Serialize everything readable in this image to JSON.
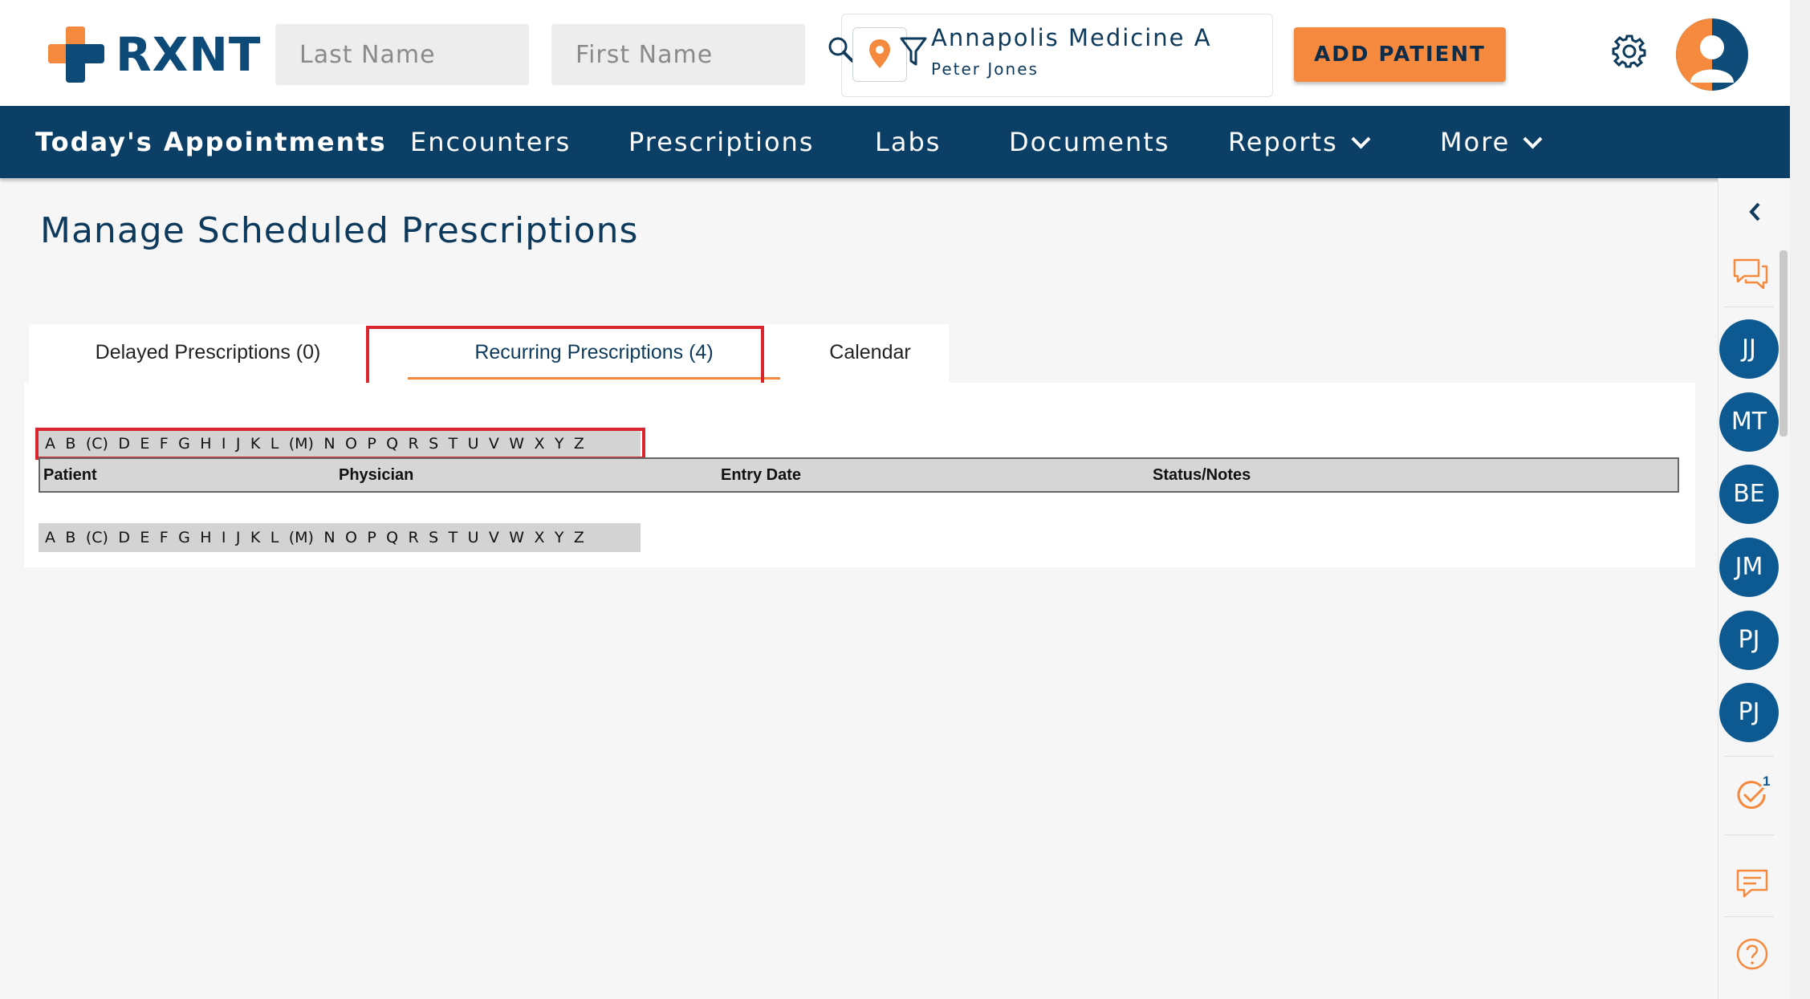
{
  "header": {
    "logo_text": "RXNT",
    "search": {
      "last_name_placeholder": "Last Name",
      "first_name_placeholder": "First Name"
    },
    "location": {
      "name": "Annapolis Medicine A",
      "user": "Peter Jones"
    },
    "add_patient_label": "ADD PATIENT",
    "colors": {
      "brand_blue": "#0e4a77",
      "accent_orange": "#f58a3f"
    }
  },
  "nav": {
    "items": [
      {
        "label": "Today's Appointments",
        "active": true
      },
      {
        "label": "Encounters"
      },
      {
        "label": "Prescriptions"
      },
      {
        "label": "Labs"
      },
      {
        "label": "Documents"
      },
      {
        "label": "Reports",
        "dropdown": true
      },
      {
        "label": "More",
        "dropdown": true
      }
    ]
  },
  "page": {
    "title": "Manage Scheduled Prescriptions",
    "tabs": [
      {
        "label": "Delayed Prescriptions (0)"
      },
      {
        "label": "Recurring Prescriptions (4)",
        "selected": true
      },
      {
        "label": "Calendar"
      }
    ],
    "alphabet": [
      "A",
      "B",
      "(C)",
      "D",
      "E",
      "F",
      "G",
      "H",
      "I",
      "J",
      "K",
      "L",
      "(M)",
      "N",
      "O",
      "P",
      "Q",
      "R",
      "S",
      "T",
      "U",
      "V",
      "W",
      "X",
      "Y",
      "Z"
    ],
    "table": {
      "columns": [
        "Patient",
        "Physician",
        "Entry Date",
        "Status/Notes"
      ]
    }
  },
  "sidebar": {
    "contacts": [
      "JJ",
      "MT",
      "BE",
      "JM",
      "PJ",
      "PJ"
    ],
    "tasks_badge": "1"
  }
}
